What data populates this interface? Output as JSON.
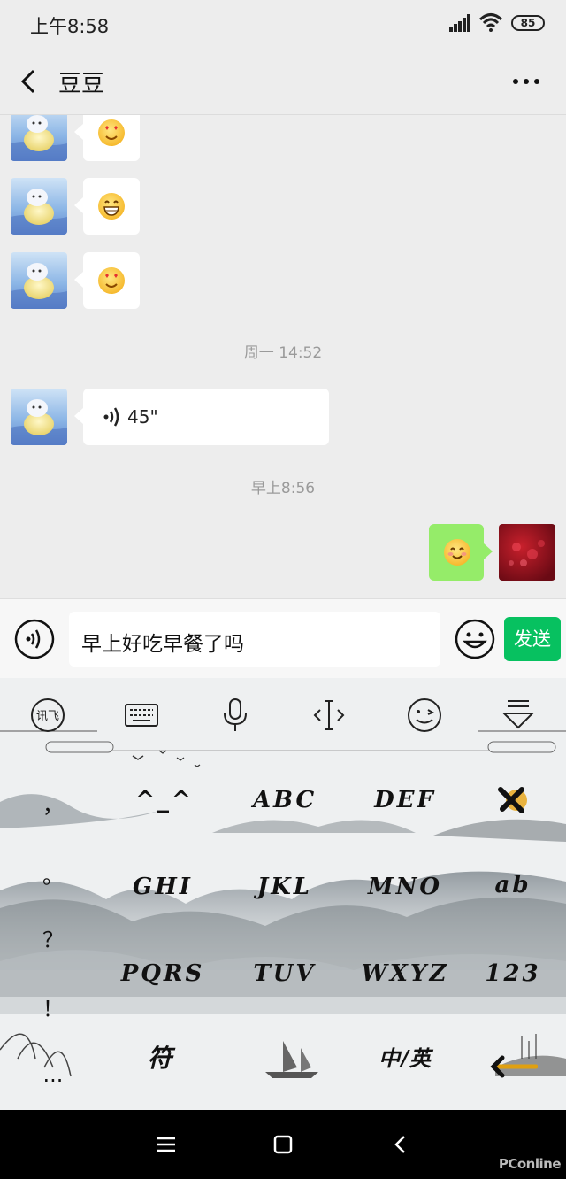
{
  "status_bar": {
    "time": "上午8:58",
    "battery": "85"
  },
  "header": {
    "title": "豆豆"
  },
  "chat": {
    "timestamps": [
      "周一 14:52",
      "早上8:56"
    ],
    "voice_message": {
      "duration": "45\""
    }
  },
  "input_bar": {
    "text": "早上好吃早餐了吗",
    "send_label": "发送"
  },
  "keyboard": {
    "keys": {
      "punct_comma": "，",
      "punct_period": "。",
      "punct_question": "？",
      "punct_exclaim": "！",
      "punct_ellipsis": "...",
      "k_emoticon": "^_^",
      "k_abc": "ABC",
      "k_def": "DEF",
      "k_ghi": "GHI",
      "k_jkl": "JKL",
      "k_mno": "MNO",
      "k_ab": "ab",
      "k_pqrs": "PQRS",
      "k_tuv": "TUV",
      "k_wxyz": "WXYZ",
      "k_123": "123",
      "k_symbol": "符",
      "k_lang": "中/英"
    }
  },
  "watermark": "PConline",
  "colors": {
    "send_green": "#07c160",
    "own_bubble": "#95ec69"
  }
}
